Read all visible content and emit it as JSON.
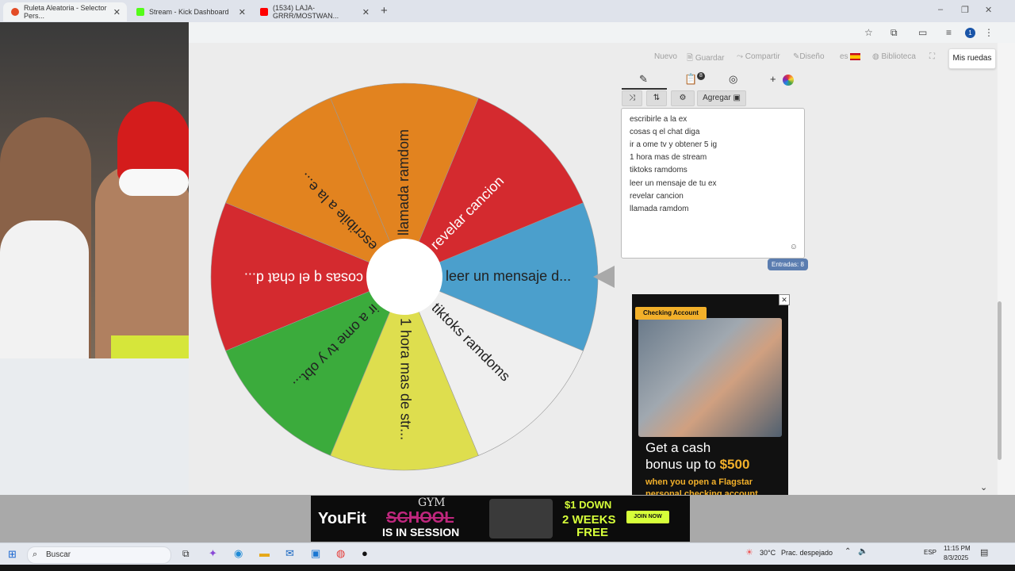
{
  "browser": {
    "tabs": [
      {
        "title": "Ruleta Aleatoria - Selector Pers...",
        "active": true,
        "icon_color": "#e34c26"
      },
      {
        "title": "Stream - Kick Dashboard",
        "active": false,
        "icon_color": "#53fc18"
      },
      {
        "title": "(1534) LAJA-GRRR/MOSTWAN...",
        "active": false,
        "icon_color": "#ff0000"
      }
    ],
    "new_tab": "+",
    "window_controls": [
      "‒",
      "❐",
      "✕"
    ],
    "profile_initial": "1"
  },
  "toolbar": {
    "nuevo": "Nuevo",
    "guardar": "Guardar",
    "compartir": "Compartir",
    "diseno": "Diseño",
    "lang": "es",
    "biblioteca": "Biblioteca",
    "mis_ruedas": "Mis ruedas"
  },
  "editor": {
    "notification_count": "8",
    "agregar_label": "Agregar",
    "entries": [
      "escribirle a la ex",
      "cosas q el chat diga",
      "ir a ome tv y obtener 5 ig",
      "1 hora mas de stream",
      "tiktoks ramdoms",
      "leer un mensaje de tu ex",
      "revelar cancion",
      "llamada ramdom"
    ],
    "entries_count_label": "Entradas: 8"
  },
  "wheel": {
    "segments": [
      {
        "label": "leer un mensaje d...",
        "color": "#4b9fcc",
        "text_color": "#222222"
      },
      {
        "label": "tiktoks ramdoms",
        "color": "#efefef",
        "text_color": "#222222"
      },
      {
        "label": "1 hora mas de str...",
        "color": "#dede4e",
        "text_color": "#222222"
      },
      {
        "label": "ir a ome tv y obt...",
        "color": "#3bab3c",
        "text_color": "#222222"
      },
      {
        "label": "cosas q el chat d...",
        "color": "#d42a2f",
        "text_color": "#ffffff"
      },
      {
        "label": "escribile a la e...",
        "color": "#e2831f",
        "text_color": "#222222"
      },
      {
        "label": "llamada ramdom",
        "color": "#e2831f",
        "text_color": "#222222"
      },
      {
        "label": "revelar cancion",
        "color": "#d42a2f",
        "text_color": "#ffffff"
      }
    ]
  },
  "ad_right": {
    "chip": "Checking Account",
    "headline_1": "Get a cash",
    "headline_2": "bonus up to",
    "amount": "$500",
    "sub": "when you open a Flagstar personal checking account.",
    "close": "✕"
  },
  "ad_bottom": {
    "brand": "YouFit",
    "gym_word": "GYM",
    "school_word": "SCHOOL",
    "tagline": "IS IN SESSION",
    "price": "$1 DOWN",
    "weeks": "2 WEEKS",
    "free": "FREE",
    "cta": "JOIN NOW"
  },
  "taskbar": {
    "search_placeholder": "Buscar",
    "weather_temp": "30°C",
    "weather_desc": "Prac. despejado",
    "lang": "ESP",
    "time": "11:15 PM",
    "date": "8/3/2025"
  }
}
